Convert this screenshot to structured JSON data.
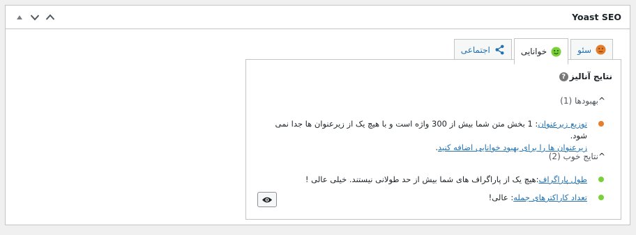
{
  "metabox": {
    "title": "Yoast SEO",
    "controls": [
      "arrow-up-small-icon",
      "chevron-down-icon",
      "chevron-up-icon"
    ]
  },
  "tabs": [
    {
      "label": "سئو",
      "icon": "sad-face-icon",
      "color": "#e47e2c",
      "active": false
    },
    {
      "label": "خوانایی",
      "icon": "smile-face-icon",
      "color": "#7ad03a",
      "active": true
    },
    {
      "label": "اجتماعی",
      "icon": "share-icon",
      "color": "#2271b1",
      "active": false
    }
  ],
  "analysis": {
    "heading": "نتایج آنالیز",
    "help_icon": "?",
    "improvements": {
      "label": "بهبودها (1)",
      "items": [
        {
          "status_color": "#e47e2c",
          "link": "توزیع زیرعنوان",
          "text": ": 1 بخش متن شما بیش از 300 واژه است و با هیچ یک از زیرعنوان ها جدا نمی شود.",
          "link2": "زیرعنوان ها را برای بهبود خوانایی اضافه کنید",
          "tail": "."
        }
      ]
    },
    "good": {
      "label": "نتایج خوب (2)",
      "items": [
        {
          "status_color": "#7ad03a",
          "link": "طول پاراگراف",
          "text": ":هیچ یک از پاراگراف های شما بیش از حد طولانی نیستند. خیلی عالی !"
        },
        {
          "status_color": "#7ad03a",
          "link": "تعداد کاراکترهای جمله",
          "text": ": عالی!"
        }
      ]
    },
    "eye_button_icon": "eye-icon"
  }
}
